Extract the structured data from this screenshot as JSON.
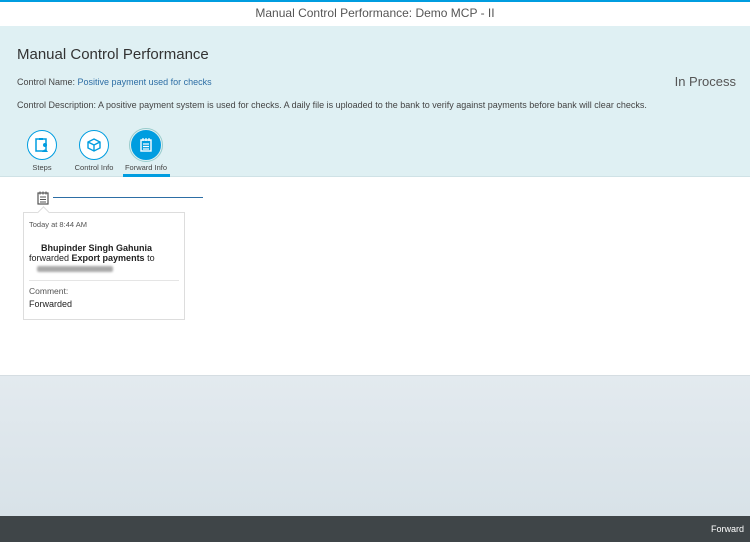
{
  "window": {
    "title": "Manual Control Performance: Demo MCP - II"
  },
  "header": {
    "title": "Manual Control Performance",
    "control_name_label": "Control Name:",
    "control_name": "Positive payment used for checks",
    "status": "In Process",
    "control_description_label": "Control Description:",
    "control_description": "A positive payment system is used for checks. A daily file is uploaded to the bank to verify against payments before bank will clear checks."
  },
  "tabs": [
    {
      "label": "Steps",
      "icon": "steps-icon"
    },
    {
      "label": "Control Info",
      "icon": "box-icon"
    },
    {
      "label": "Forward Info",
      "icon": "notepad-icon",
      "active": true
    }
  ],
  "timeline": [
    {
      "time": "Today at 8:44 AM",
      "user": "Bhupinder Singh Gahunia",
      "action": "forwarded",
      "item": "Export payments",
      "to": "to",
      "comment_label": "Comment:",
      "comment": "Forwarded"
    }
  ],
  "footer": {
    "forward_label": "Forward"
  },
  "colors": {
    "accent": "#009de0",
    "header_bg": "#dff0f3",
    "footer_bg": "#3f4548"
  }
}
